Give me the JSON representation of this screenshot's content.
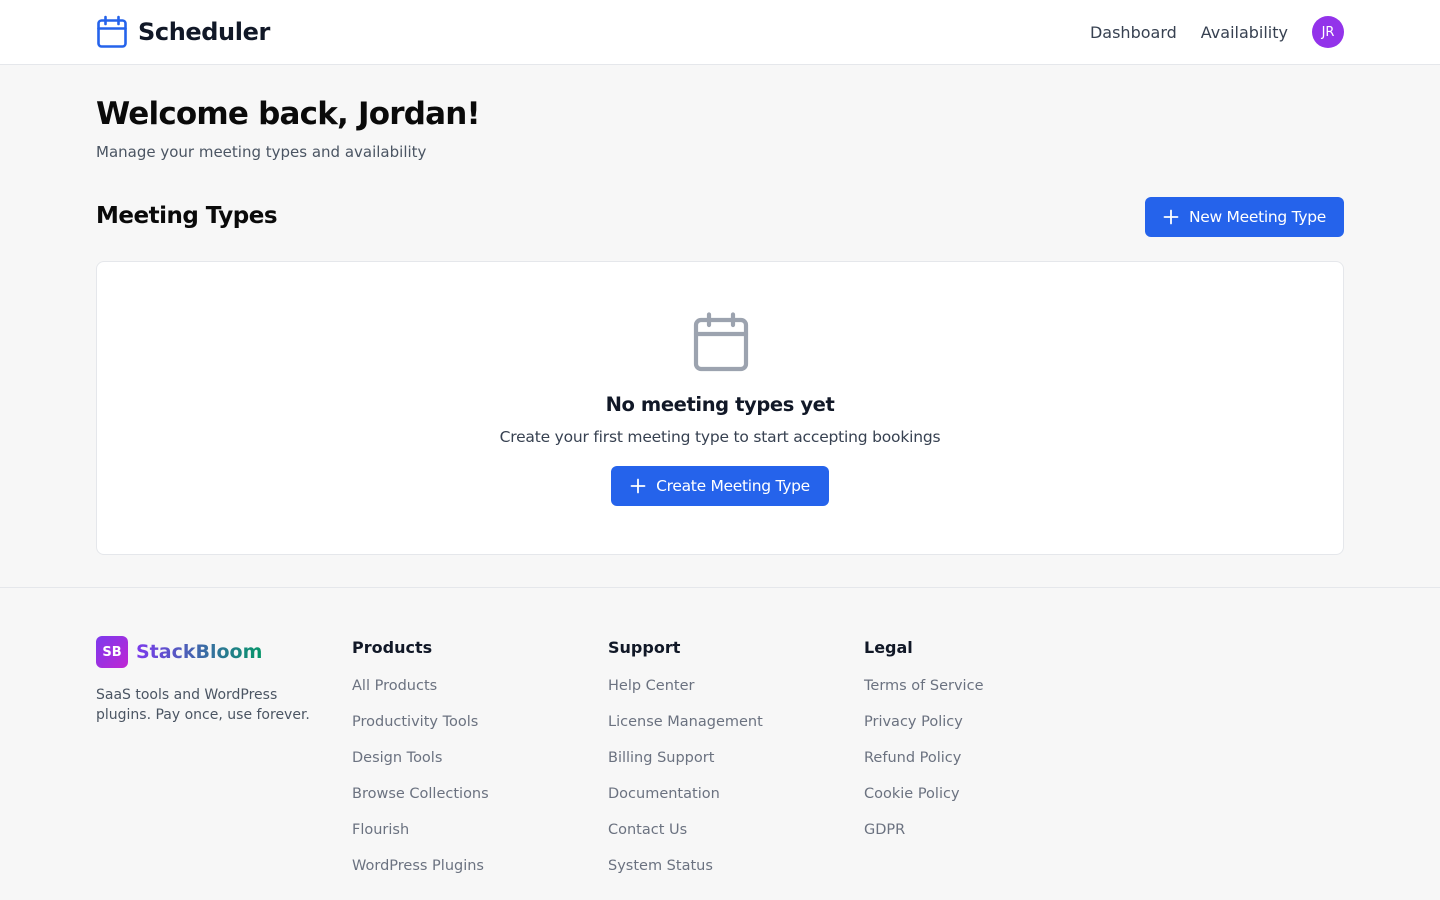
{
  "header": {
    "app_name": "Scheduler",
    "nav": [
      {
        "label": "Dashboard"
      },
      {
        "label": "Availability"
      }
    ],
    "avatar_initials": "JR",
    "avatar_color": "#9333ea"
  },
  "main": {
    "welcome_title": "Welcome back, Jordan!",
    "welcome_subtitle": "Manage your meeting types and availability",
    "section_title": "Meeting Types",
    "new_button_label": "New Meeting Type",
    "empty_state": {
      "icon": "calendar-icon",
      "title": "No meeting types yet",
      "subtitle": "Create your first meeting type to start accepting bookings",
      "button_label": "Create Meeting Type"
    }
  },
  "footer": {
    "brand_initials": "SB",
    "brand_name": "StackBloom",
    "tagline": "SaaS tools and WordPress plugins. Pay once, use forever.",
    "columns": [
      {
        "title": "Products",
        "links": [
          "All Products",
          "Productivity Tools",
          "Design Tools",
          "Browse Collections",
          "Flourish",
          "WordPress Plugins"
        ]
      },
      {
        "title": "Support",
        "links": [
          "Help Center",
          "License Management",
          "Billing Support",
          "Documentation",
          "Contact Us",
          "System Status"
        ]
      },
      {
        "title": "Legal",
        "links": [
          "Terms of Service",
          "Privacy Policy",
          "Refund Policy",
          "Cookie Policy",
          "GDPR"
        ]
      }
    ]
  },
  "colors": {
    "accent": "#2563eb",
    "page_background": "#f7f7f7"
  }
}
